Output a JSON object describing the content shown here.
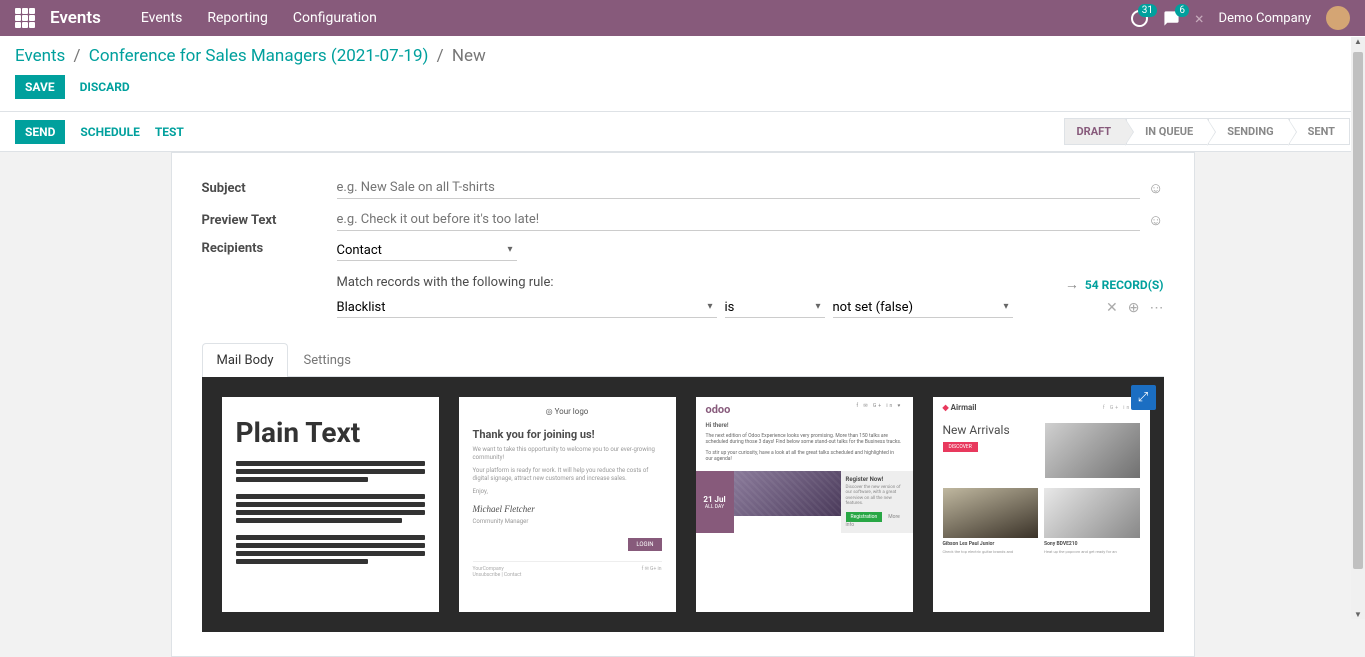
{
  "navbar": {
    "app_name": "Events",
    "menus": [
      "Events",
      "Reporting",
      "Configuration"
    ],
    "activity_count": "31",
    "chat_count": "6",
    "company": "Demo Company"
  },
  "breadcrumbs": {
    "root": "Events",
    "parent": "Conference for Sales Managers (2021-07-19)",
    "current": "New"
  },
  "actions": {
    "save": "SAVE",
    "discard": "DISCARD"
  },
  "subactions": {
    "send": "SEND",
    "schedule": "SCHEDULE",
    "test": "TEST"
  },
  "status": {
    "draft": "DRAFT",
    "in_queue": "IN QUEUE",
    "sending": "SENDING",
    "sent": "SENT"
  },
  "form": {
    "subject_label": "Subject",
    "subject_placeholder": "e.g. New Sale on all T-shirts",
    "preview_label": "Preview Text",
    "preview_placeholder": "e.g. Check it out before it's too late!",
    "recipients_label": "Recipients",
    "recipients_value": "Contact",
    "match_text": "Match records with the following rule:",
    "records_link": "54 RECORD(S)",
    "filter_field": "Blacklist",
    "filter_op": "is",
    "filter_value": "not set (false)"
  },
  "tabs": {
    "mail_body": "Mail Body",
    "settings": "Settings"
  },
  "templates": {
    "plain_title": "Plain Text",
    "join": {
      "logo": "◎ Your logo",
      "heading": "Thank you for joining us!",
      "p1": "We want to take this opportunity to welcome you to our ever-growing community!",
      "p2": "Your platform is ready for work. It will help you reduce the costs of digital signage, attract new customers and increase sales.",
      "p3": "Enjoy,",
      "sig": "Michael Fletcher",
      "role": "Community Manager",
      "login": "LOGIN",
      "company": "YourCompany",
      "unsub": "Unsubscribe | Contact"
    },
    "odoo": {
      "brand": "odoo",
      "social": "f ✉ G+ in ♥",
      "hi": "Hi there!",
      "p1": "The next edition of Odoo Experience looks very promising. More than 150 talks are scheduled during those 3 days! Find below some stand-out talks for the Business tracks.",
      "p2": "To stir up your curiosity, have a look at all the great talks scheduled and highlighted in our agenda!",
      "date_num": "21 Jul",
      "date_sub": "ALL DAY",
      "reg_title": "Register Now!",
      "reg_text": "Discover the new version of our software, with a great overview on all the new features.",
      "reg_btn": "Registration",
      "more": "More info"
    },
    "air": {
      "brand": "Airmail",
      "social": "f G+ in ♥",
      "heading": "New Arrivals",
      "discover": "DISCOVER",
      "prod1_name": "Gibson Les Paul Junior",
      "prod1_desc": "Check the top electric guitar brands and",
      "prod2_name": "Sony BDVE210",
      "prod2_desc": "Heat up the popcorn and get ready for an"
    }
  }
}
